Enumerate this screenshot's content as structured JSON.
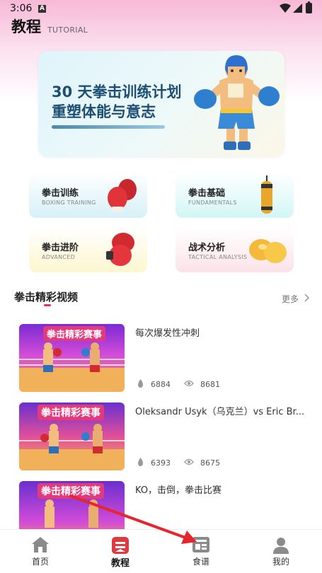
{
  "status_bar": {
    "time": "3:06",
    "notif_badge": "A"
  },
  "header": {
    "title": "教程",
    "subtitle": "TUTORIAL"
  },
  "banner": {
    "line1": "30 天拳击训练计划",
    "line2": "重塑体能与意志"
  },
  "categories": [
    {
      "title": "拳击训练",
      "subtitle": "BOXING TRAINING",
      "icon": "boxing-gloves-icon"
    },
    {
      "title": "拳击基础",
      "subtitle": "FUNDAMENTALS",
      "icon": "punching-bag-icon"
    },
    {
      "title": "拳击进阶",
      "subtitle": "ADVANCED",
      "icon": "boxing-gloves-icon"
    },
    {
      "title": "战术分析",
      "subtitle": "TACTICAL ANALYSIS",
      "icon": "gold-gloves-icon"
    }
  ],
  "section": {
    "title": "拳击精彩视频",
    "more": "更多"
  },
  "videos": [
    {
      "title": "每次爆发性冲刺",
      "thumb_text": "拳击精彩赛事",
      "likes": "6884",
      "views": "8681"
    },
    {
      "title": "Oleksandr Usyk（乌克兰）vs Eric Br...",
      "thumb_text": "拳击精彩赛事",
      "likes": "6393",
      "views": "8675"
    },
    {
      "title": "KO，击倒，拳击比赛",
      "thumb_text": "拳击精彩赛事"
    }
  ],
  "nav": [
    {
      "label": "首页",
      "icon": "home-icon",
      "active": false
    },
    {
      "label": "教程",
      "icon": "tutorial-icon",
      "active": true
    },
    {
      "label": "食谱",
      "icon": "recipe-icon",
      "active": false
    },
    {
      "label": "我的",
      "icon": "profile-icon",
      "active": false
    }
  ],
  "colors": {
    "accent": "#e0305b",
    "banner_text": "#1d4e74",
    "arrow": "#e8252b"
  }
}
